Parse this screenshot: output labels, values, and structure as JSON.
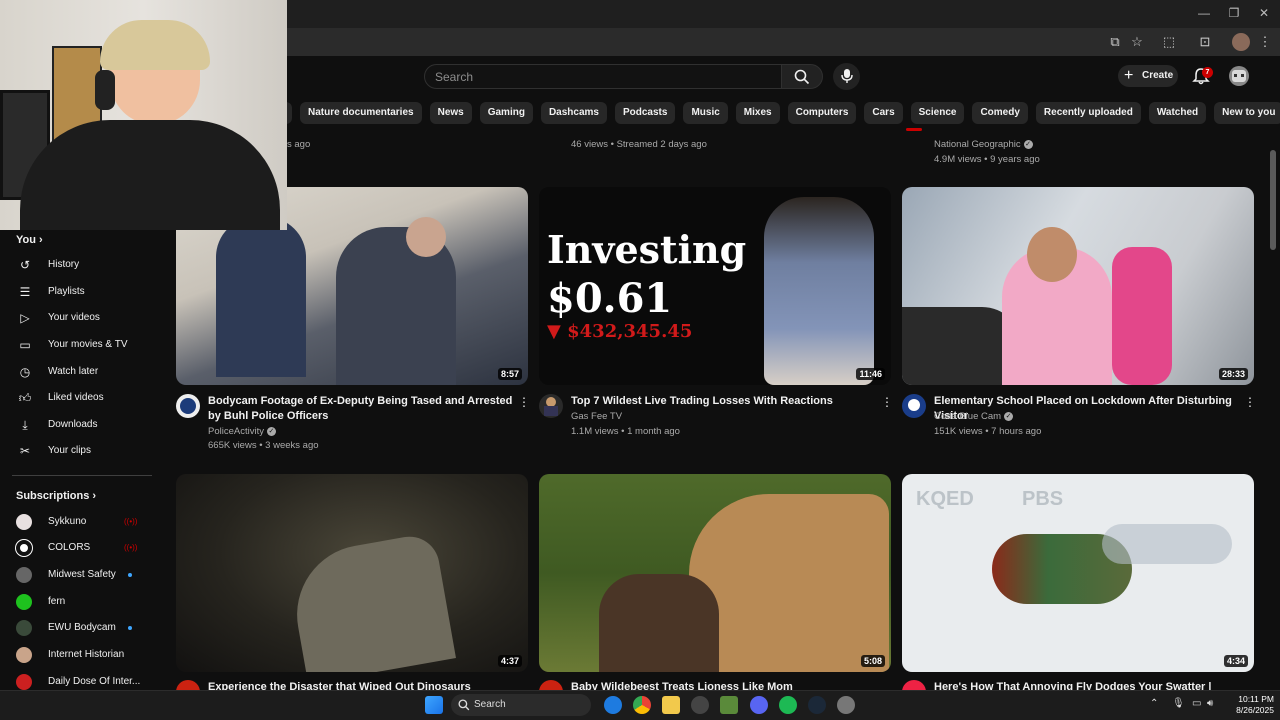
{
  "search": {
    "placeholder": "Search"
  },
  "header": {
    "create_label": "Create",
    "notif_count": "7"
  },
  "chips": [
    "Nature documentaries",
    "News",
    "Gaming",
    "Dashcams",
    "Podcasts",
    "Music",
    "Mixes",
    "Computers",
    "Cars",
    "Science",
    "Comedy",
    "Recently uploaded",
    "Watched",
    "New to you"
  ],
  "top_row": [
    {
      "meta2": "s ago"
    },
    {
      "meta2": "46 views • Streamed 2 days ago"
    },
    {
      "channel": "National Geographic",
      "meta2": "4.9M views • 9 years ago"
    }
  ],
  "sidebar": {
    "you_label": "You",
    "items": [
      {
        "label": "History",
        "icon": "history-icon"
      },
      {
        "label": "Playlists",
        "icon": "playlists-icon"
      },
      {
        "label": "Your videos",
        "icon": "your-videos-icon"
      },
      {
        "label": "Your movies & TV",
        "icon": "movies-icon"
      },
      {
        "label": "Watch later",
        "icon": "clock-icon"
      },
      {
        "label": "Liked videos",
        "icon": "thumbs-up-icon"
      },
      {
        "label": "Downloads",
        "icon": "download-icon"
      },
      {
        "label": "Your clips",
        "icon": "scissors-icon"
      }
    ],
    "subscriptions_label": "Subscriptions",
    "subscriptions": [
      {
        "name": "Sykkuno",
        "status": "live"
      },
      {
        "name": "COLORS",
        "status": "live"
      },
      {
        "name": "Midwest Safety",
        "status": "new"
      },
      {
        "name": "fern",
        "status": ""
      },
      {
        "name": "EWU Bodycam",
        "status": "new"
      },
      {
        "name": "Internet Historian",
        "status": ""
      },
      {
        "name": "Daily Dose Of Inter...",
        "status": ""
      }
    ]
  },
  "videos": [
    {
      "title": "Bodycam Footage of Ex-Deputy Being Tased and Arrested by Buhl Police Officers",
      "channel": "PoliceActivity",
      "meta": "665K views • 3 weeks ago",
      "duration": "8:57",
      "thumb_text": ""
    },
    {
      "title": "Top 7 Wildest Live Trading Losses With Reactions",
      "channel": "Gas Fee TV",
      "meta": "1.1M views • 1 month ago",
      "duration": "11:46",
      "thumb_line1": "Investing",
      "thumb_line2": "$0.61",
      "thumb_line3": "$432,345.45"
    },
    {
      "title": "Elementary School Placed on Lockdown After Disturbing Visitor",
      "channel": "Code Blue Cam",
      "meta": "151K views • 7 hours ago",
      "duration": "28:33"
    },
    {
      "title": "Experience the Disaster that Wiped Out Dinosaurs",
      "duration": "4:37"
    },
    {
      "title": "Baby Wildebeest Treats Lioness Like Mom",
      "duration": "5:08"
    },
    {
      "title": "Here's How That Annoying Fly Dodges Your Swatter | Deep Look",
      "duration": "4:34",
      "thumb_watermark1": "KQED",
      "thumb_watermark2": "PBS"
    }
  ],
  "taskbar": {
    "search_label": "Search",
    "time": "10:11 PM",
    "date": "8/26/2025"
  }
}
